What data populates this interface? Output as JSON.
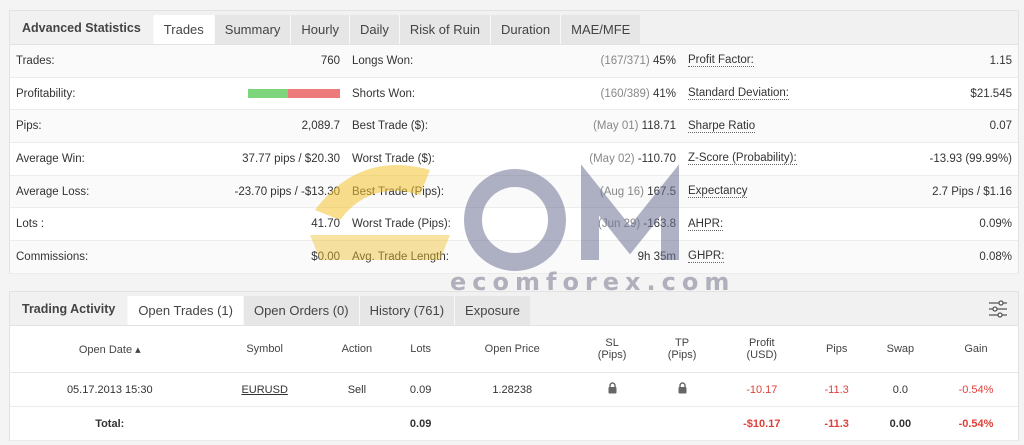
{
  "stats_tabs": {
    "title": "Advanced Statistics",
    "items": [
      "Trades",
      "Summary",
      "Hourly",
      "Daily",
      "Risk of Ruin",
      "Duration",
      "MAE/MFE"
    ]
  },
  "col1": [
    {
      "label": "Trades:",
      "value": "760"
    },
    {
      "label": "Profitability:",
      "value": ""
    },
    {
      "label": "Pips:",
      "value": "2,089.7"
    },
    {
      "label": "Average Win:",
      "value": "37.77 pips / $20.30"
    },
    {
      "label": "Average Loss:",
      "value": "-23.70 pips / -$13.30"
    },
    {
      "label": "Lots :",
      "value": "41.70"
    },
    {
      "label": "Commissions:",
      "value": "$0.00"
    }
  ],
  "col2": [
    {
      "label": "Longs Won:",
      "muted": "(167/371)",
      "value": "45%"
    },
    {
      "label": "Shorts Won:",
      "muted": "(160/389)",
      "value": "41%"
    },
    {
      "label": "Best Trade ($):",
      "muted": "(May 01)",
      "value": "118.71"
    },
    {
      "label": "Worst Trade ($):",
      "muted": "(May 02)",
      "value": "-110.70"
    },
    {
      "label": "Best Trade (Pips):",
      "muted": "(Aug 16)",
      "value": "167.5"
    },
    {
      "label": "Worst Trade (Pips):",
      "muted": "(Jun 29)",
      "value": "-163.8"
    },
    {
      "label": "Avg. Trade Length:",
      "muted": "",
      "value": "9h 35m"
    }
  ],
  "col3": [
    {
      "label": "Profit Factor:",
      "value": "1.15"
    },
    {
      "label": "Standard Deviation:",
      "value": "$21.545"
    },
    {
      "label": "Sharpe Ratio",
      "value": "0.07"
    },
    {
      "label": "Z-Score (Probability):",
      "value": "-13.93 (99.99%)"
    },
    {
      "label": "Expectancy",
      "value": "2.7 Pips / $1.16"
    },
    {
      "label": "AHPR:",
      "value": "0.09%"
    },
    {
      "label": "GHPR:",
      "value": "0.08%"
    }
  ],
  "activity_tabs": {
    "title": "Trading Activity",
    "items": [
      "Open Trades (1)",
      "Open Orders (0)",
      "History (761)",
      "Exposure"
    ]
  },
  "table": {
    "headers": [
      "Open Date ▴",
      "Symbol",
      "Action",
      "Lots",
      "Open Price",
      "SL\n(Pips)",
      "TP\n(Pips)",
      "Profit\n(USD)",
      "Pips",
      "Swap",
      "Gain"
    ],
    "row": {
      "date": "05.17.2013 15:30",
      "symbol": "EURUSD",
      "action": "Sell",
      "lots": "0.09",
      "price": "1.28238",
      "profit": "-10.17",
      "pips": "-11.3",
      "swap": "0.0",
      "gain": "-0.54%"
    },
    "total": {
      "label": "Total:",
      "lots": "0.09",
      "profit": "-$10.17",
      "pips": "-11.3",
      "swap": "0.00",
      "gain": "-0.54%"
    }
  },
  "profitability": {
    "won_fraction": 0.43
  },
  "watermark": {
    "text": "ecomforex.com"
  },
  "colors": {
    "accent_yellow": "#f2c230",
    "negative": "#e0403a",
    "positive_bar": "#7dd67b",
    "negative_bar": "#ee7b7b"
  }
}
